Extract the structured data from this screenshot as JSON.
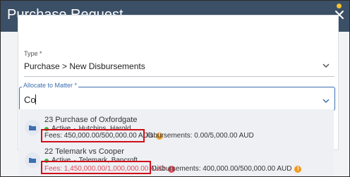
{
  "dialog": {
    "title": "Purchase Request"
  },
  "type_field": {
    "label": "Type *",
    "value": "Purchase > New Disbursements"
  },
  "allocate_field": {
    "label": "Allocate to Matter *",
    "value": "Co"
  },
  "results": [
    {
      "title": "23 Purchase of Oxfordgate",
      "status": "Active",
      "separator": "·",
      "client": "Hutchins, Harold",
      "fees": "Fees: 450,000.00/500,000.00 AUD",
      "fees_icon": "!",
      "disbursements": "Disbursements: 0.00/5,000.00 AUD"
    },
    {
      "title": "22 Telemark vs Cooper",
      "status": "Active",
      "separator": "·",
      "client": "Telemark, Bancroft",
      "fees": "Fees: 1,450,000.00/1,000,000.00 AUD",
      "fees_icon": "!",
      "disbursements": "Disbursements: 400,000.00/500,000.00 AUD",
      "disbursements_icon": "!"
    }
  ],
  "colors": {
    "header": "#3b4f66",
    "accent": "#3d6fb0",
    "active": "#38b24a",
    "warning": "#f29b1d",
    "error": "#e24a5a",
    "highlight_box": "#d10f18"
  },
  "icons": [
    "notification-dot-icon",
    "close-icon",
    "chevron-down-icon",
    "folder-icon",
    "status-dot-icon",
    "warning-icon",
    "error-icon"
  ]
}
